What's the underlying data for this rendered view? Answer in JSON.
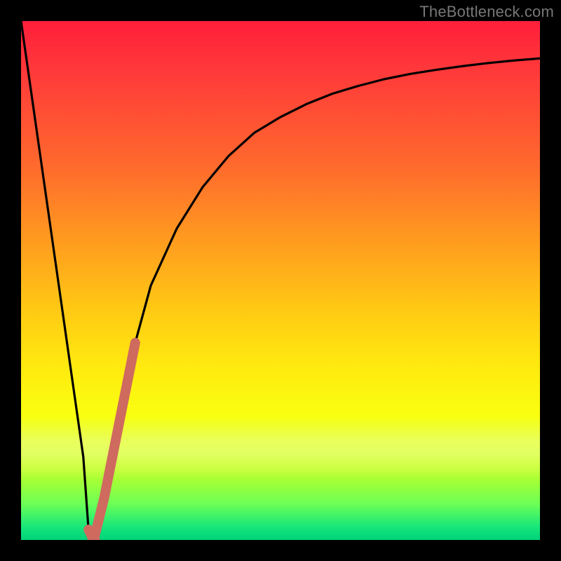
{
  "watermark": "TheBottleneck.com",
  "colors": {
    "frame": "#000000",
    "curve_stroke": "#000000",
    "highlight_stroke": "#cf6a5f",
    "gradient_top": "#ff1e3a",
    "gradient_bottom": "#00d27a"
  },
  "chart_data": {
    "type": "line",
    "title": "",
    "xlabel": "",
    "ylabel": "",
    "xlim": [
      0,
      100
    ],
    "ylim": [
      0,
      100
    ],
    "grid": false,
    "legend": false,
    "annotations": [
      {
        "name": "highlight_segment",
        "x_start": 13,
        "x_end": 22
      }
    ],
    "series": [
      {
        "name": "bottleneck_curve",
        "x": [
          0,
          2,
          4,
          6,
          8,
          10,
          12,
          13,
          14,
          16,
          18,
          20,
          22,
          25,
          30,
          35,
          40,
          45,
          50,
          55,
          60,
          65,
          70,
          75,
          80,
          85,
          90,
          95,
          100
        ],
        "values": [
          100,
          86,
          72,
          58,
          44,
          30,
          16,
          2,
          0,
          8,
          18,
          28,
          38,
          49,
          60,
          68,
          74,
          78.5,
          81.5,
          84,
          86,
          87.5,
          88.8,
          89.8,
          90.6,
          91.3,
          91.9,
          92.4,
          92.8
        ]
      }
    ]
  }
}
